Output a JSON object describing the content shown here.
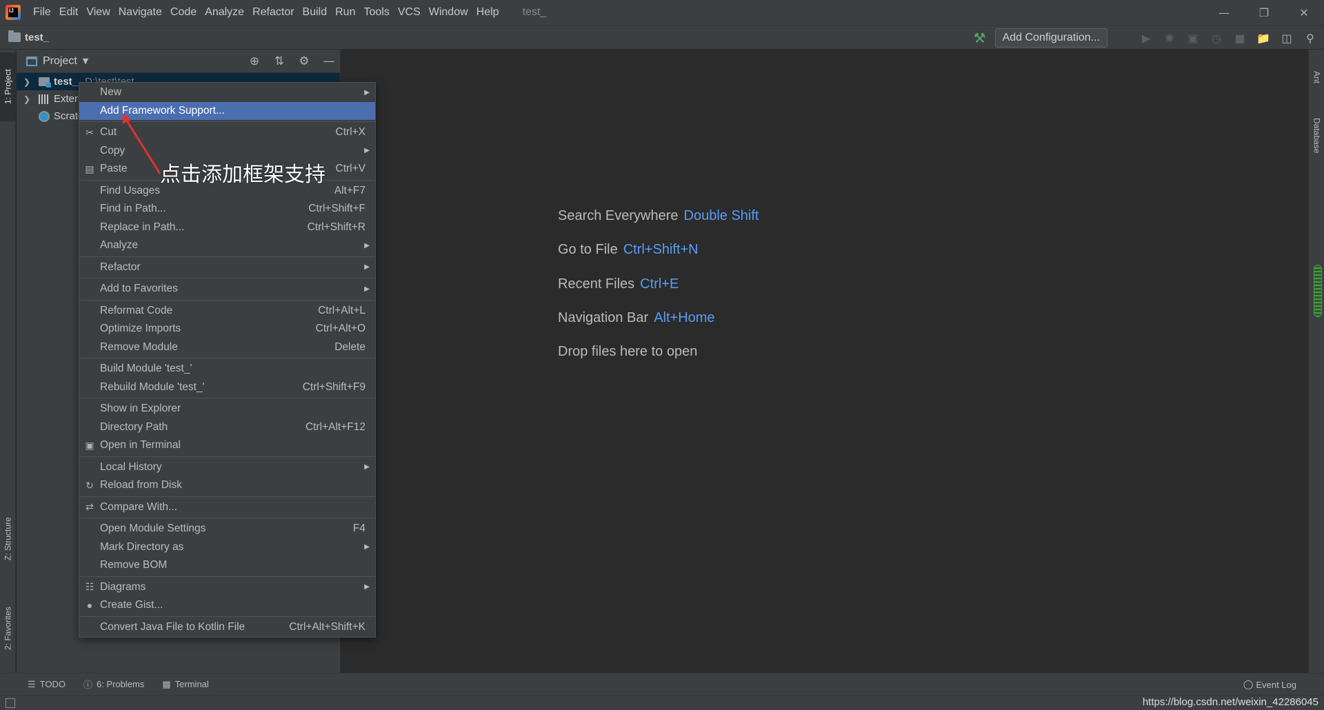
{
  "window": {
    "menus": [
      "File",
      "Edit",
      "View",
      "Navigate",
      "Code",
      "Analyze",
      "Refactor",
      "Build",
      "Run",
      "Tools",
      "VCS",
      "Window",
      "Help"
    ],
    "title": "test_",
    "controls": [
      "minimize-icon",
      "restore-icon",
      "close-icon"
    ],
    "logo": "IJ"
  },
  "navbar": {
    "breadcrumb": "test_",
    "add_configuration": "Add Configuration..."
  },
  "left_strip": {
    "project_tab": "1: Project",
    "structure_tab": "Z: Structure",
    "favorites_tab": "2: Favorites"
  },
  "right_strip": {
    "ant_tab": "Ant",
    "database_tab": "Database"
  },
  "project_panel": {
    "title": "Project",
    "tree": [
      {
        "label": "test_",
        "path": "D:\\test\\test_"
      },
      {
        "label": "External Libraries"
      },
      {
        "label": "Scratches and Consoles"
      }
    ]
  },
  "context_menu": {
    "items": [
      {
        "label": "New",
        "submenu": true
      },
      {
        "label": "Add Framework Support...",
        "highlighted": true
      },
      {
        "sep": true
      },
      {
        "label": "Cut",
        "shortcut": "Ctrl+X",
        "icon": "scissors-icon"
      },
      {
        "label": "Copy",
        "submenu": true
      },
      {
        "label": "Paste",
        "shortcut": "Ctrl+V",
        "icon": "clipboard-icon"
      },
      {
        "sep": true
      },
      {
        "label": "Find Usages",
        "shortcut": "Alt+F7"
      },
      {
        "label": "Find in Path...",
        "shortcut": "Ctrl+Shift+F"
      },
      {
        "label": "Replace in Path...",
        "shortcut": "Ctrl+Shift+R"
      },
      {
        "label": "Analyze",
        "submenu": true
      },
      {
        "sep": true
      },
      {
        "label": "Refactor",
        "submenu": true
      },
      {
        "sep": true
      },
      {
        "label": "Add to Favorites",
        "submenu": true
      },
      {
        "sep": true
      },
      {
        "label": "Reformat Code",
        "shortcut": "Ctrl+Alt+L"
      },
      {
        "label": "Optimize Imports",
        "shortcut": "Ctrl+Alt+O"
      },
      {
        "label": "Remove Module",
        "shortcut": "Delete"
      },
      {
        "sep": true
      },
      {
        "label": "Build Module 'test_'"
      },
      {
        "label": "Rebuild Module 'test_'",
        "shortcut": "Ctrl+Shift+F9"
      },
      {
        "sep": true
      },
      {
        "label": "Show in Explorer"
      },
      {
        "label": "Directory Path",
        "shortcut": "Ctrl+Alt+F12"
      },
      {
        "label": "Open in Terminal",
        "icon": "terminal-icon"
      },
      {
        "sep": true
      },
      {
        "label": "Local History",
        "submenu": true
      },
      {
        "label": "Reload from Disk",
        "icon": "reload-icon"
      },
      {
        "sep": true
      },
      {
        "label": "Compare With...",
        "icon": "compare-icon"
      },
      {
        "sep": true
      },
      {
        "label": "Open Module Settings",
        "shortcut": "F4"
      },
      {
        "label": "Mark Directory as",
        "submenu": true
      },
      {
        "label": "Remove BOM"
      },
      {
        "sep": true
      },
      {
        "label": "Diagrams",
        "submenu": true,
        "icon": "diagram-icon"
      },
      {
        "label": "Create Gist...",
        "icon": "github-icon"
      },
      {
        "sep": true
      },
      {
        "label": "Convert Java File to Kotlin File",
        "shortcut": "Ctrl+Alt+Shift+K"
      }
    ]
  },
  "annotation": {
    "text": "点击添加框架支持",
    "color": "#ffffff",
    "arrow_color": "#e03030"
  },
  "editor": {
    "hints": [
      {
        "label": "Search Everywhere",
        "key": "Double Shift"
      },
      {
        "label": "Go to File",
        "key": "Ctrl+Shift+N"
      },
      {
        "label": "Recent Files",
        "key": "Ctrl+E"
      },
      {
        "label": "Navigation Bar",
        "key": "Alt+Home"
      },
      {
        "label": "Drop files here to open",
        "key": ""
      }
    ]
  },
  "bottom_tools": {
    "todo": "TODO",
    "problems": "6: Problems",
    "terminal": "Terminal",
    "event_log": "Event Log"
  },
  "watermark": "https://blog.csdn.net/weixin_42286045",
  "colors": {
    "accent": "#4b6eaf",
    "hint_key": "#589df6",
    "background": "#2b2b2b",
    "panel": "#3c3f41"
  }
}
